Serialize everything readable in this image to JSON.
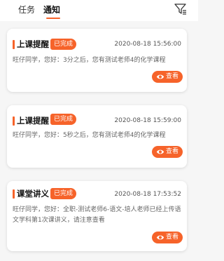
{
  "tabs": [
    {
      "label": "任务",
      "active": false
    },
    {
      "label": "通知",
      "active": true
    }
  ],
  "filter_icon": "filter-icon",
  "colors": {
    "accent": "#f6632a",
    "background": "#f6f6f6",
    "card": "#ffffff"
  },
  "notifications": [
    {
      "title": "上课提醒",
      "status": "已完成",
      "time": "2020-08-18 15:56:00",
      "content": "旺仔同学，您好：3分之后，您有测试老师4的化学课程",
      "action_label": "查看",
      "action_icon": "eye-icon"
    },
    {
      "title": "上课提醒",
      "status": "已完成",
      "time": "2020-08-18 15:59:00",
      "content": "旺仔同学，您好：5秒之后，您有测试老师4的化学课程",
      "action_label": "查看",
      "action_icon": "eye-icon"
    },
    {
      "title": "课堂讲义",
      "status": "已完成",
      "time": "2020-08-18 17:53:52",
      "content": "旺仔同学，您好：全职-测试老师6-语文-培人老师已经上传语文学科第1次课讲义，请注意查看",
      "action_label": "查看",
      "action_icon": "eye-icon"
    }
  ]
}
